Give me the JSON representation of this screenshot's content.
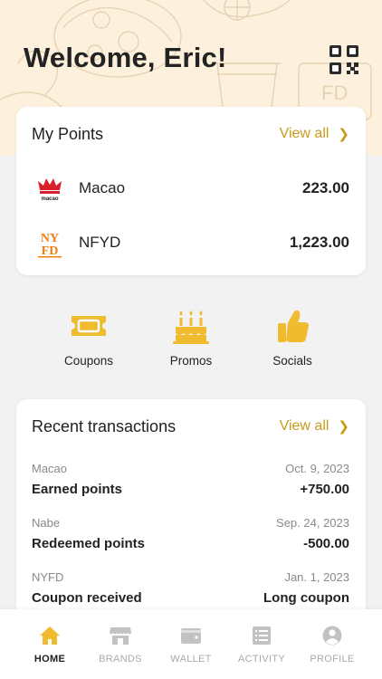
{
  "header": {
    "welcome": "Welcome, Eric!"
  },
  "points": {
    "title": "My Points",
    "view_all": "View all",
    "items": [
      {
        "brand": "Macao",
        "logo_text": "macao",
        "value": "223.00"
      },
      {
        "brand": "NFYD",
        "logo_text": "NYFD",
        "value": "1,223.00"
      }
    ]
  },
  "shortcuts": [
    {
      "label": "Coupons",
      "icon": "ticket-icon"
    },
    {
      "label": "Promos",
      "icon": "cake-icon"
    },
    {
      "label": "Socials",
      "icon": "thumbs-up-icon"
    }
  ],
  "transactions": {
    "title": "Recent transactions",
    "view_all": "View all",
    "items": [
      {
        "brand": "Macao",
        "date": "Oct. 9, 2023",
        "desc": "Earned points",
        "amount": "+750.00"
      },
      {
        "brand": "Nabe",
        "date": "Sep. 24, 2023",
        "desc": "Redeemed points",
        "amount": "-500.00"
      },
      {
        "brand": "NYFD",
        "date": "Jan. 1, 2023",
        "desc": "Coupon received",
        "amount": "Long coupon"
      }
    ]
  },
  "nav": [
    {
      "label": "HOME",
      "icon": "home-icon",
      "active": true
    },
    {
      "label": "BRANDS",
      "icon": "store-icon",
      "active": false
    },
    {
      "label": "WALLET",
      "icon": "wallet-icon",
      "active": false
    },
    {
      "label": "ACTIVITY",
      "icon": "list-icon",
      "active": false
    },
    {
      "label": "PROFILE",
      "icon": "user-icon",
      "active": false
    }
  ],
  "colors": {
    "accent": "#f0bb2e",
    "link": "#c99a1e",
    "hero_bg": "#fdf1de",
    "page_bg": "#f2f2f2",
    "macao_red": "#d8202a",
    "nyfd_orange": "#f07f12"
  }
}
